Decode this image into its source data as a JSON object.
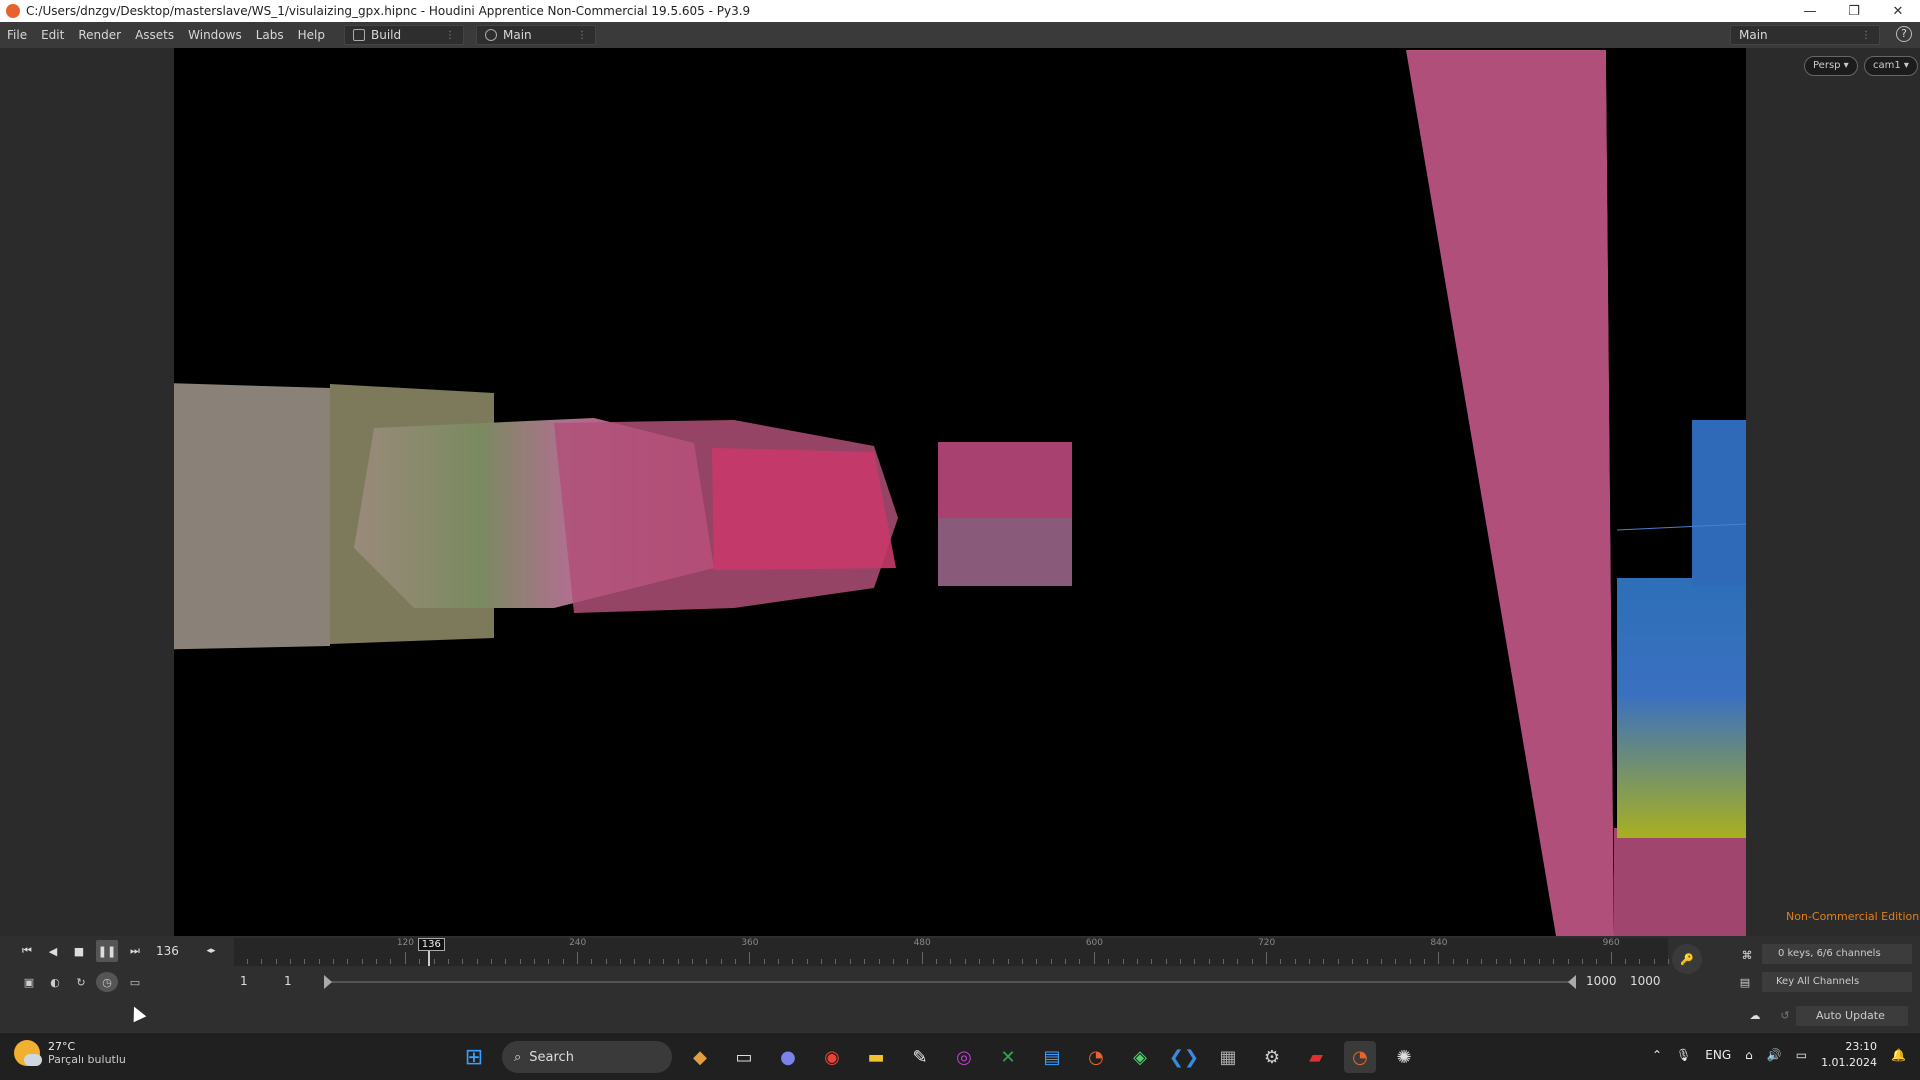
{
  "window": {
    "title": "C:/Users/dnzgv/Desktop/masterslave/WS_1/visulaizing_gpx.hipnc - Houdini Apprentice Non-Commercial 19.5.605 - Py3.9",
    "minimize": "—",
    "restore": "❐",
    "close": "✕"
  },
  "menu": {
    "items": [
      "File",
      "Edit",
      "Render",
      "Assets",
      "Windows",
      "Labs",
      "Help"
    ],
    "desktop_build": "Build",
    "desktop_main": "Main",
    "right_desktop": "Main",
    "help_icon": "?"
  },
  "viewport": {
    "persp": "Persp ▾",
    "cam": "cam1 ▾",
    "edition": "Non-Commercial Edition"
  },
  "playbar": {
    "current_frame": "136",
    "playhead_label": "136",
    "ticks": [
      {
        "frame": 120,
        "label": "120"
      },
      {
        "frame": 240,
        "label": "240"
      },
      {
        "frame": 360,
        "label": "360"
      },
      {
        "frame": 480,
        "label": "480"
      },
      {
        "frame": 600,
        "label": "600"
      },
      {
        "frame": 720,
        "label": "720"
      },
      {
        "frame": 840,
        "label": "840"
      },
      {
        "frame": 960,
        "label": "960"
      }
    ],
    "range_start_a": "1",
    "range_start_b": "1",
    "range_end_a": "1000",
    "range_end_b": "1000",
    "keys_info": "0 keys, 6/6 channels",
    "key_all": "Key All Channels",
    "auto_update": "Auto Update"
  },
  "taskbar": {
    "weather_temp": "27°C",
    "weather_desc": "Parçalı bulutlu",
    "search": "Search",
    "lang": "ENG",
    "time": "23:10",
    "date": "1.01.2024"
  }
}
